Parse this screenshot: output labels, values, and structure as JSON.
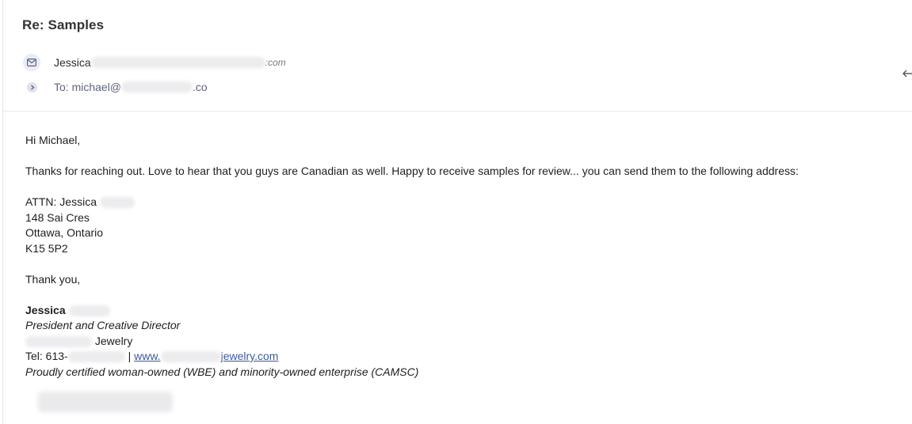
{
  "email": {
    "subject": "Re: Samples",
    "from_name": "Jessica",
    "from_domain_suffix": ":com",
    "to_prefix": "To: michael@",
    "to_suffix": ".co"
  },
  "body": {
    "greeting": "Hi Michael,",
    "paragraph": "Thanks for reaching out. Love to hear that you guys are Canadian as well. Happy to receive samples for review... you can send them to the following address:",
    "address": {
      "attn": "ATTN: Jessica",
      "street": "148 Sai Cres",
      "city": "Ottawa, Ontario",
      "postal": "K15 5P2"
    },
    "closing": "Thank you,",
    "signature": {
      "name": "Jessica",
      "title": "President and Creative Director",
      "company_suffix": "Jewelry",
      "tel_prefix": "Tel: 613-",
      "separator": "|",
      "web_prefix": "www.",
      "web_suffix": "jewelry.com",
      "certification": "Proudly certified woman-owned (WBE) and minority-owned enterprise (CAMSC)"
    }
  },
  "icons": {
    "sender": "mail-icon",
    "expand": "chevron-right-icon",
    "reply": "reply-arrow-icon"
  }
}
